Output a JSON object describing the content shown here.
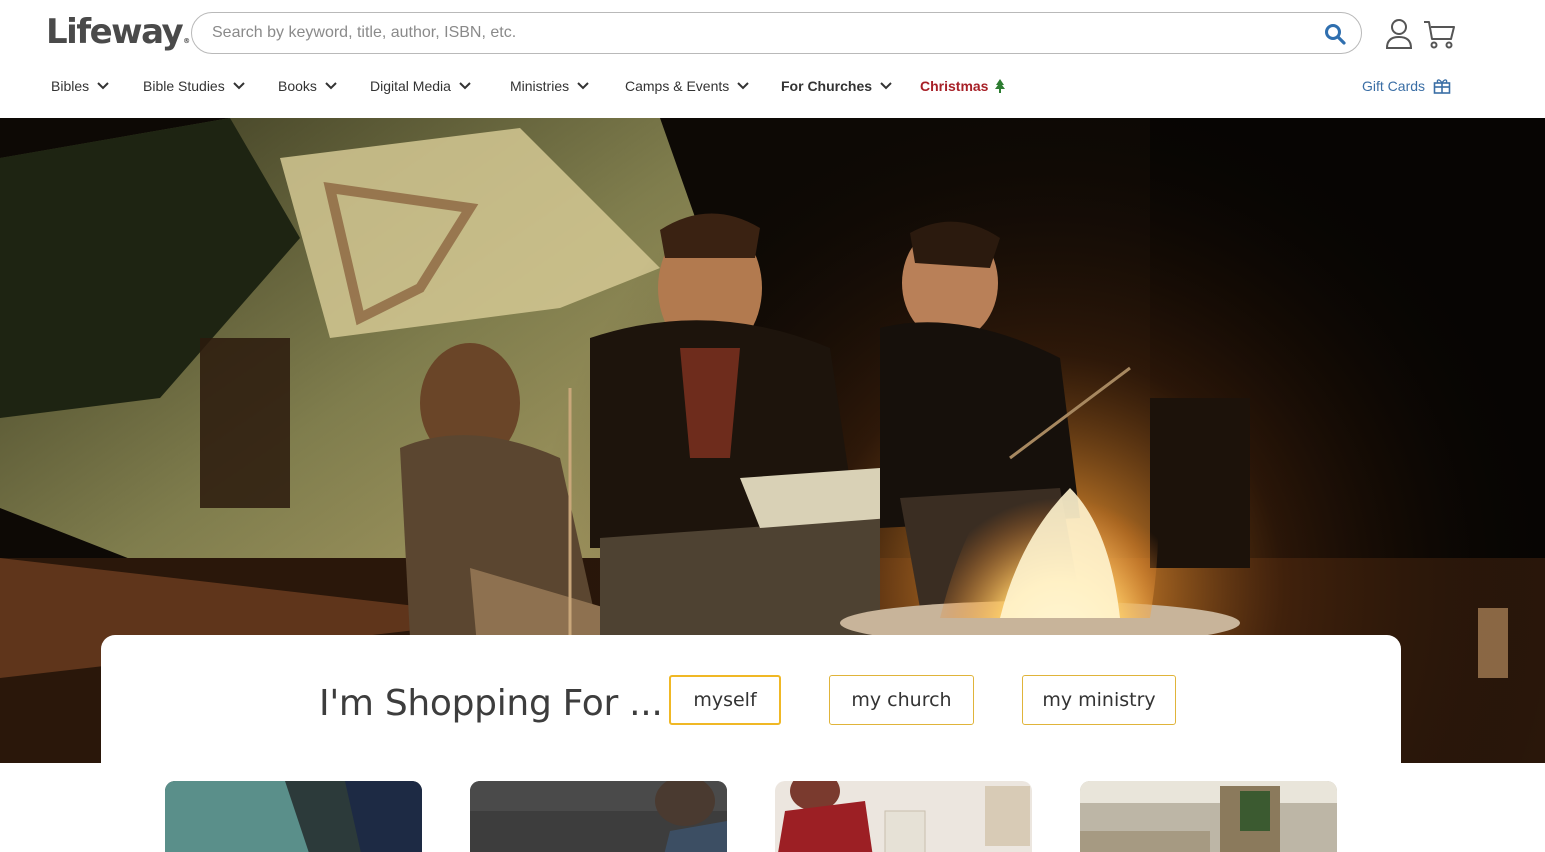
{
  "brand": {
    "logo_text": "Lifeway",
    "logo_mark": "®"
  },
  "search": {
    "placeholder": "Search by keyword, title, author, ISBN, etc.",
    "value": ""
  },
  "nav": {
    "items": [
      {
        "label": "Bibles"
      },
      {
        "label": "Bible Studies"
      },
      {
        "label": "Books"
      },
      {
        "label": "Digital Media"
      },
      {
        "label": "Ministries"
      },
      {
        "label": "Camps & Events"
      },
      {
        "label": "For Churches"
      },
      {
        "label": "Christmas"
      }
    ],
    "gift_cards": "Gift Cards"
  },
  "shopping": {
    "title": "I'm Shopping For ...",
    "options": [
      {
        "label": "myself",
        "selected": true
      },
      {
        "label": "my church",
        "selected": false
      },
      {
        "label": "my ministry",
        "selected": false
      }
    ]
  },
  "colors": {
    "accent_gold": "#f0b825",
    "christmas_red": "#a72027",
    "link_blue": "#3a6ea5",
    "icon_blue": "#2f6faf",
    "tree_green": "#2e7d32"
  }
}
